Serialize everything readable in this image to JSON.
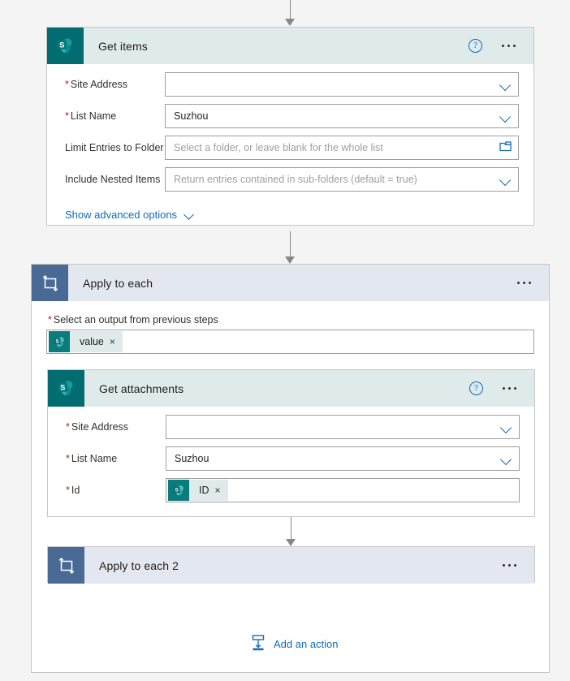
{
  "theme": {
    "page_bg": "#f4f4f4",
    "sharepoint_teal": "#036c70",
    "loop_blue": "#4a6a96",
    "link_blue": "#0f6cbd",
    "required_red": "#a4262c",
    "card_border": "#c8c6c4"
  },
  "get_items": {
    "title": "Get items",
    "icon": "sharepoint-icon",
    "help": "?",
    "fields": [
      {
        "label": "Site Address",
        "required": true,
        "value": "",
        "placeholder": "",
        "control": "dropdown"
      },
      {
        "label": "List Name",
        "required": true,
        "value": "Suzhou",
        "placeholder": "",
        "control": "dropdown"
      },
      {
        "label": "Limit Entries to Folder",
        "required": false,
        "value": "",
        "placeholder": "Select a folder, or leave blank for the whole list",
        "control": "folder-picker"
      },
      {
        "label": "Include Nested Items",
        "required": false,
        "value": "",
        "placeholder": "Return entries contained in sub-folders (default = true)",
        "control": "dropdown"
      }
    ],
    "advanced_link": "Show advanced options"
  },
  "apply_to_each": {
    "title": "Apply to each",
    "icon": "loop-icon",
    "output_label": "Select an output from previous steps",
    "output_required": true,
    "token": {
      "label": "value",
      "icon": "sharepoint-icon",
      "remove": "×"
    }
  },
  "get_attachments": {
    "title": "Get attachments",
    "icon": "sharepoint-icon",
    "help": "?",
    "fields": [
      {
        "label": "Site Address",
        "required": true,
        "value": "",
        "placeholder": "",
        "control": "dropdown"
      },
      {
        "label": "List Name",
        "required": true,
        "value": "Suzhou",
        "placeholder": "",
        "control": "dropdown"
      }
    ],
    "id_field": {
      "label": "Id",
      "required": true,
      "token": {
        "label": "ID",
        "icon": "sharepoint-icon",
        "remove": "×"
      }
    }
  },
  "apply_to_each_2": {
    "title": "Apply to each 2",
    "icon": "loop-icon"
  },
  "add_action": {
    "label": "Add an action",
    "icon": "add-action-icon"
  }
}
